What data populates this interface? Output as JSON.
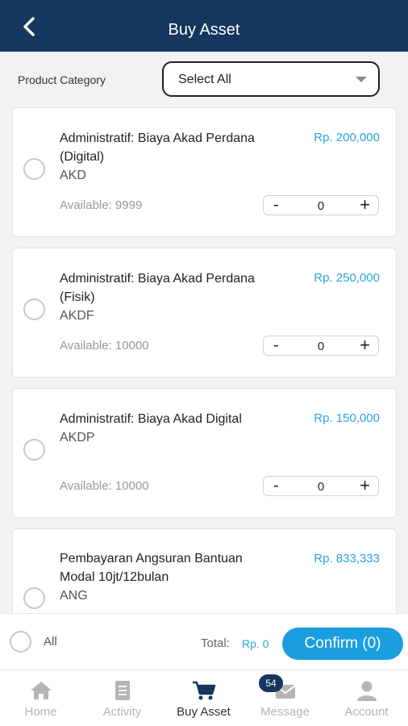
{
  "header": {
    "title": "Buy Asset"
  },
  "filter": {
    "label": "Product Category",
    "selected": "Select All"
  },
  "products": [
    {
      "name": "Administratif: Biaya Akad Perdana (Digital)",
      "code": "AKD",
      "price": "Rp. 200,000",
      "available": "Available: 9999",
      "quantity": "0"
    },
    {
      "name": "Administratif: Biaya Akad Perdana (Fisik)",
      "code": "AKDF",
      "price": "Rp. 250,000",
      "available": "Available: 10000",
      "quantity": "0"
    },
    {
      "name": "Administratif: Biaya Akad Digital",
      "code": "AKDP",
      "price": "Rp. 150,000",
      "available": "Available: 10000",
      "quantity": "0"
    },
    {
      "name": "Pembayaran Angsuran Bantuan Modal 10jt/12bulan",
      "code": "ANG",
      "price": "Rp. 833,333"
    }
  ],
  "stepper": {
    "minus": "-",
    "plus": "+"
  },
  "footer": {
    "all_label": "All",
    "total_label": "Total:",
    "total_value": "Rp. 0",
    "confirm_label": "Confirm (0)"
  },
  "tabs": [
    {
      "label": "Home",
      "icon": "home-icon"
    },
    {
      "label": "Activity",
      "icon": "document-icon"
    },
    {
      "label": "Buy Asset",
      "icon": "cart-icon"
    },
    {
      "label": "Message",
      "icon": "envelope-icon",
      "badge": "54"
    },
    {
      "label": "Account",
      "icon": "person-icon"
    }
  ],
  "colors": {
    "header": "#15365e",
    "accent": "#1a9ee0",
    "price": "#2aa3e0"
  }
}
